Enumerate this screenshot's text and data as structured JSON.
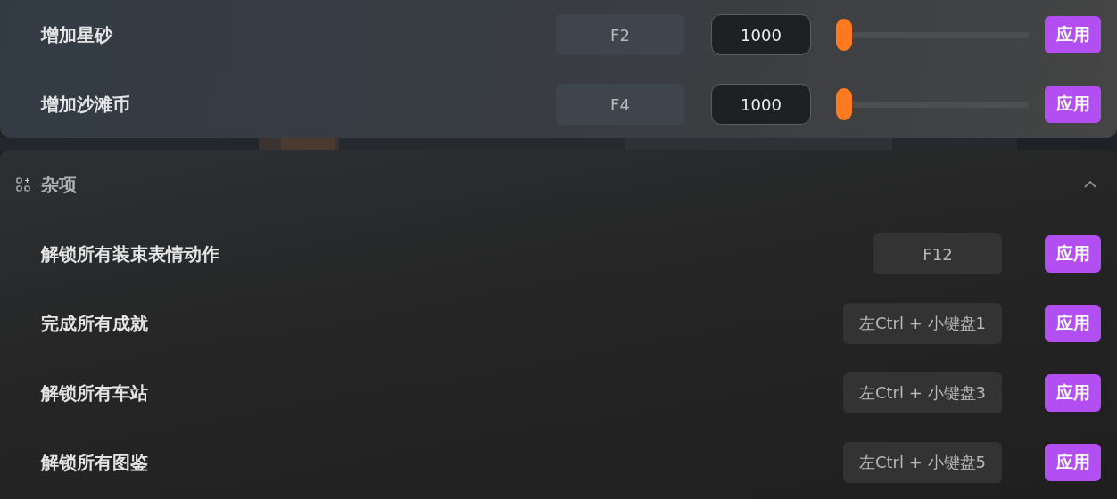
{
  "top_panel": {
    "rows": [
      {
        "label": "增加星砂",
        "hotkey": "F2",
        "value": "1000",
        "level": 0,
        "button": "应用"
      },
      {
        "label": "增加沙滩币",
        "hotkey": "F4",
        "value": "1000",
        "level": 0,
        "button": "应用"
      }
    ]
  },
  "misc_section": {
    "title": "杂项",
    "expanded": true,
    "rows": [
      {
        "label": "解锁所有装束表情动作",
        "hotkey": "F12",
        "button": "应用"
      },
      {
        "label": "完成所有成就",
        "hotkey": "左Ctrl + 小键盘1",
        "button": "应用"
      },
      {
        "label": "解锁所有车站",
        "hotkey": "左Ctrl + 小键盘3",
        "button": "应用"
      },
      {
        "label": "解锁所有图鉴",
        "hotkey": "左Ctrl + 小键盘5",
        "button": "应用"
      }
    ]
  }
}
